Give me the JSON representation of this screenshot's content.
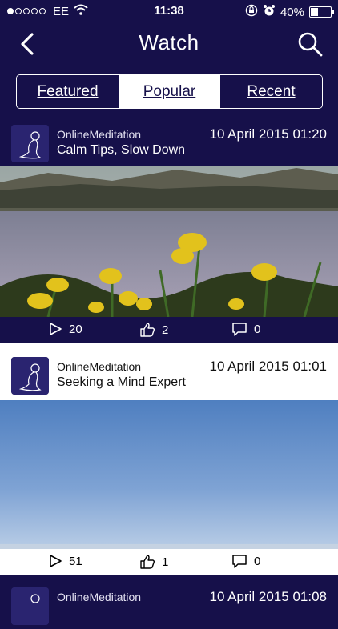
{
  "status": {
    "carrier": "EE",
    "time": "11:38",
    "battery": "40%",
    "battery_level": 0.4
  },
  "nav": {
    "title": "Watch"
  },
  "tabs": [
    {
      "label": "Featured",
      "active": false
    },
    {
      "label": "Popular",
      "active": true
    },
    {
      "label": "Recent",
      "active": false
    }
  ],
  "videos": [
    {
      "channel": "OnlineMeditation",
      "date": "10 April 2015 01:20",
      "title": "Calm Tips, Slow Down",
      "plays": "20",
      "likes": "2",
      "comments": "0"
    },
    {
      "channel": "OnlineMeditation",
      "date": "10 April 2015 01:01",
      "title": "Seeking a Mind Expert",
      "plays": "51",
      "likes": "1",
      "comments": "0"
    },
    {
      "channel": "OnlineMeditation",
      "date": "10 April 2015 01:08"
    }
  ],
  "colors": {
    "background": "#16104a",
    "text": "#ffffff"
  }
}
